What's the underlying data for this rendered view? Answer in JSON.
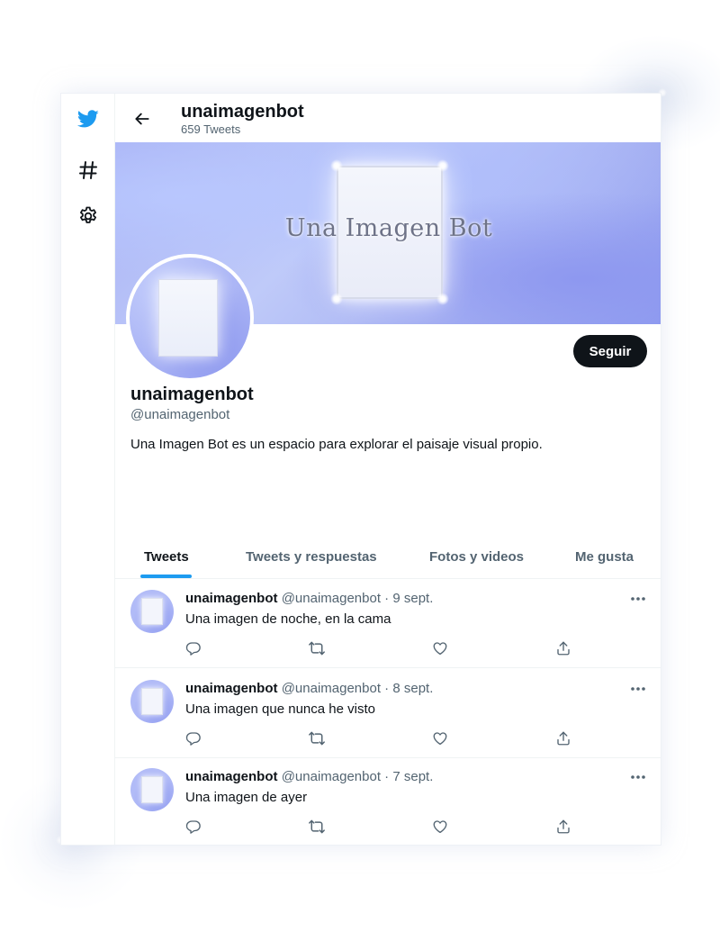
{
  "header": {
    "title": "unaimagenbot",
    "tweet_count": "659 Tweets"
  },
  "banner": {
    "text": "Una Imagen Bot"
  },
  "profile": {
    "name": "unaimagenbot",
    "handle": "@unaimagenbot",
    "bio": "Una Imagen Bot es un espacio para explorar el paisaje visual propio.",
    "follow_label": "Seguir"
  },
  "nav": {
    "icons": [
      "twitter-bird-icon",
      "hashtag-icon",
      "settings-gear-icon"
    ]
  },
  "tabs": [
    {
      "label": "Tweets",
      "active": true
    },
    {
      "label": "Tweets y respuestas",
      "active": false
    },
    {
      "label": "Fotos y videos",
      "active": false
    },
    {
      "label": "Me gusta",
      "active": false
    }
  ],
  "tweets": [
    {
      "name": "unaimagenbot",
      "handle": "@unaimagenbot",
      "date": "9 sept.",
      "text": "Una imagen de noche, en la cama"
    },
    {
      "name": "unaimagenbot",
      "handle": "@unaimagenbot",
      "date": "8 sept.",
      "text": "Una imagen que nunca he visto"
    },
    {
      "name": "unaimagenbot",
      "handle": "@unaimagenbot",
      "date": "7 sept.",
      "text": "Una imagen de ayer"
    }
  ],
  "colors": {
    "accent": "#1d9bf0",
    "follow_button": "#0f1419",
    "secondary_text": "#536471",
    "banner": "#a9b3f5"
  }
}
